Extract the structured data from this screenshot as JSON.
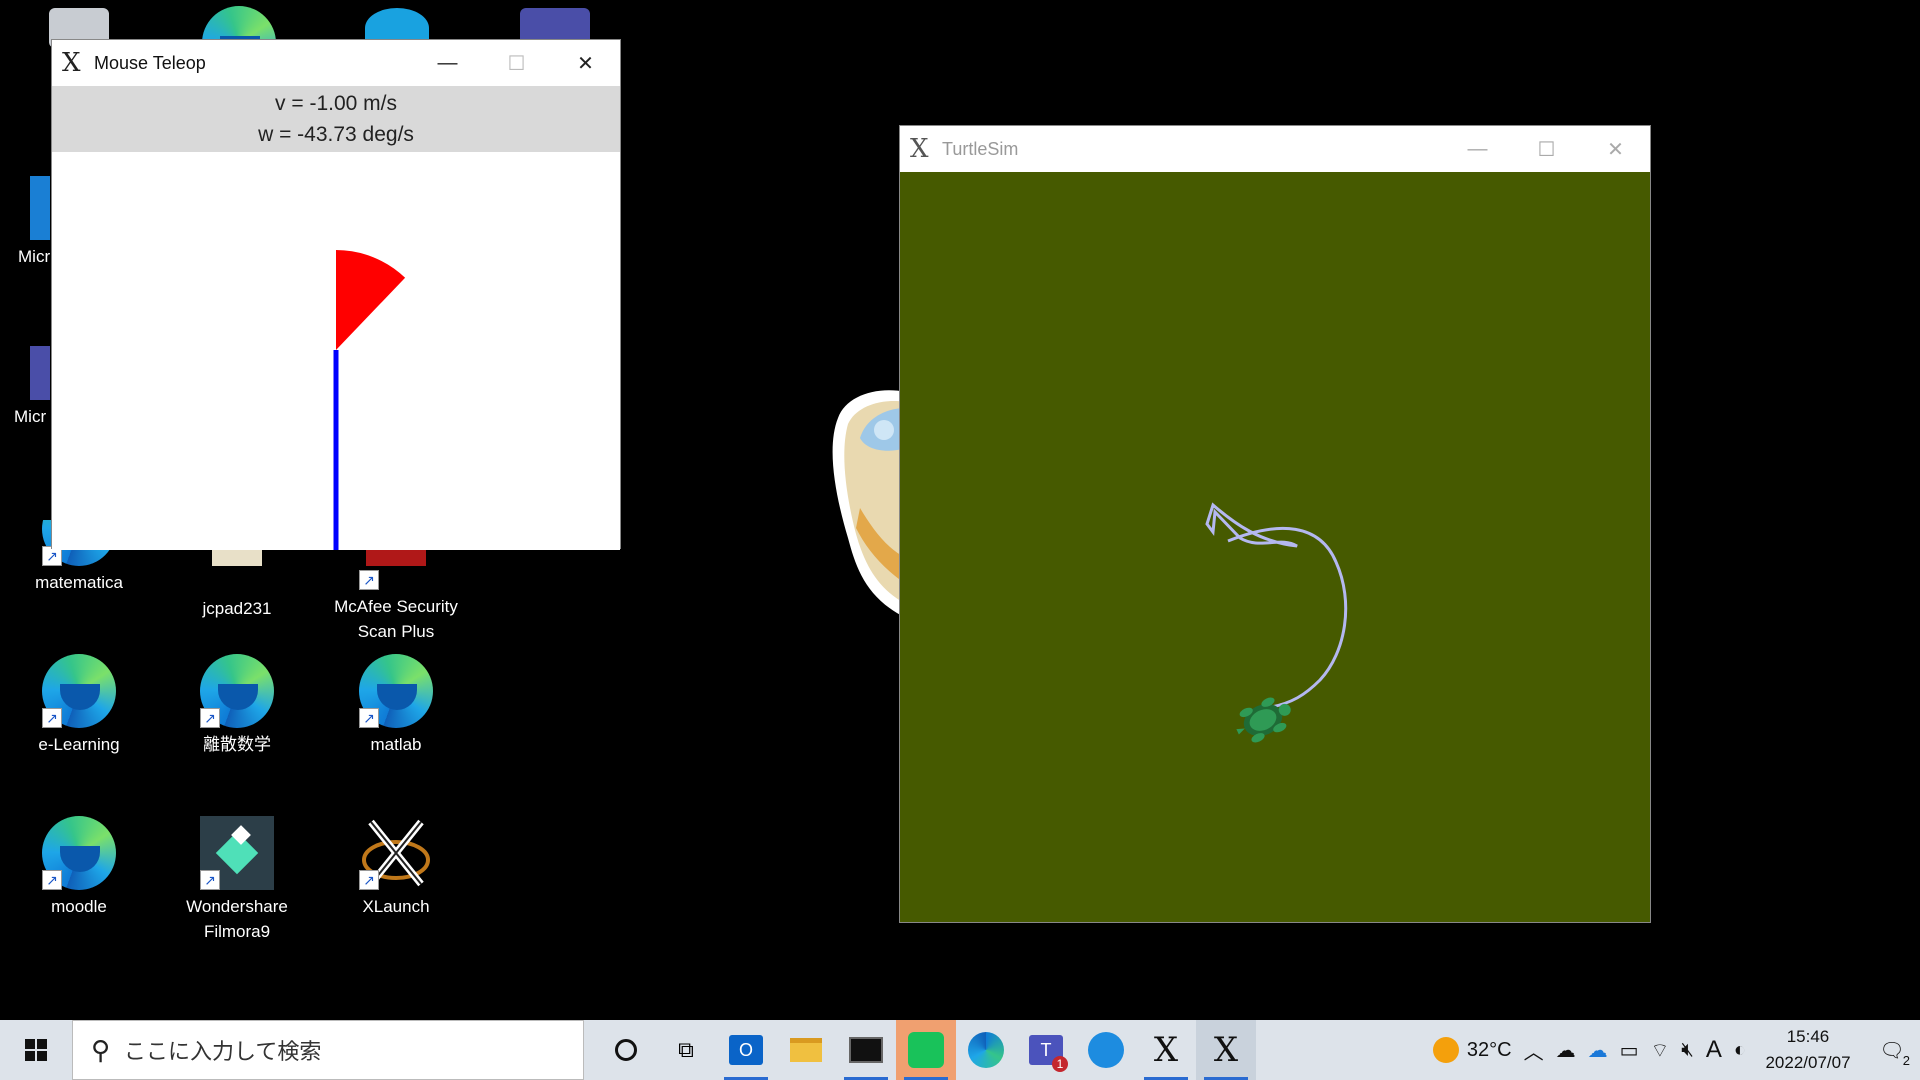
{
  "desktop": {
    "icons": [
      {
        "label": "Micr"
      },
      {
        "label": "Micr"
      },
      {
        "label": "matematica"
      },
      {
        "label": "jcpad231"
      },
      {
        "label": "McAfee Security Scan Plus"
      },
      {
        "label": "e-Learning"
      },
      {
        "label": "離散数学"
      },
      {
        "label": "matlab"
      },
      {
        "label": "moodle"
      },
      {
        "label": "Wondershare Filmora9"
      },
      {
        "label": "XLaunch"
      }
    ]
  },
  "teleop_window": {
    "title": "Mouse Teleop",
    "linear": "v = -1.00 m/s",
    "angular": "w = -43.73 deg/s",
    "linear_bar_fraction": -1.0,
    "angular_deg_per_s": -43.73,
    "colors": {
      "linear_bar": "#0000ff",
      "angular_wedge": "#ff0000"
    }
  },
  "turtlesim_window": {
    "title": "TurtleSim",
    "colors": {
      "background": "#465a00",
      "trail": "#b4b8f0",
      "turtle": "#2a8a4a"
    }
  },
  "taskbar": {
    "search_placeholder": "ここに入力して検索",
    "apps": [
      "cortana-icon",
      "task-view-icon",
      "outlook-icon",
      "file-explorer-icon",
      "terminal-icon",
      "teams-classroom-icon",
      "edge-icon",
      "teams-icon",
      "docker-icon",
      "xlaunch-icon",
      "xlaunch-icon"
    ],
    "teams_badge": "1",
    "weather": "32°C",
    "ime": "A",
    "time": "15:46",
    "date": "2022/07/07",
    "notifications_count": "2"
  }
}
